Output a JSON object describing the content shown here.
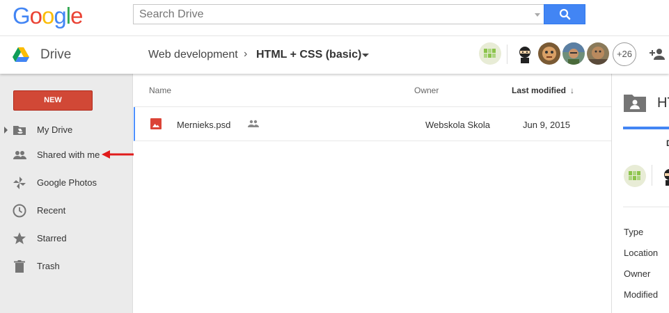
{
  "header": {
    "logo_letters": [
      "G",
      "o",
      "o",
      "g",
      "l",
      "e"
    ],
    "logo_colors": [
      "#4285f4",
      "#ea4335",
      "#fbbc05",
      "#4285f4",
      "#34a853",
      "#ea4335"
    ],
    "search_placeholder": "Search Drive"
  },
  "subheader": {
    "app_name": "Drive",
    "breadcrumb_parent": "Web development",
    "breadcrumb_sep": "›",
    "breadcrumb_current": "HTML + CSS (basic)",
    "extra_sharers": "+26"
  },
  "sidebar": {
    "new_label": "NEW",
    "items": [
      {
        "label": "My Drive",
        "icon": "drive-folder-icon"
      },
      {
        "label": "Shared with me",
        "icon": "people-icon"
      },
      {
        "label": "Google Photos",
        "icon": "photos-pinwheel-icon"
      },
      {
        "label": "Recent",
        "icon": "clock-icon"
      },
      {
        "label": "Starred",
        "icon": "star-icon"
      },
      {
        "label": "Trash",
        "icon": "trash-icon"
      }
    ]
  },
  "table": {
    "columns": {
      "name": "Name",
      "owner": "Owner",
      "modified": "Last modified",
      "sort_arrow": "↓"
    },
    "rows": [
      {
        "name": "Mernieks.psd",
        "owner": "Webskola Skola",
        "modified": "Jun 9, 2015"
      }
    ]
  },
  "details": {
    "title_partial": "HT",
    "section_partial": "D",
    "labels": [
      "Type",
      "Location",
      "Owner",
      "Modified"
    ]
  },
  "colors": {
    "accent_blue": "#4285f4",
    "new_button_red": "#d14836",
    "arrow_red": "#e01b1b"
  }
}
